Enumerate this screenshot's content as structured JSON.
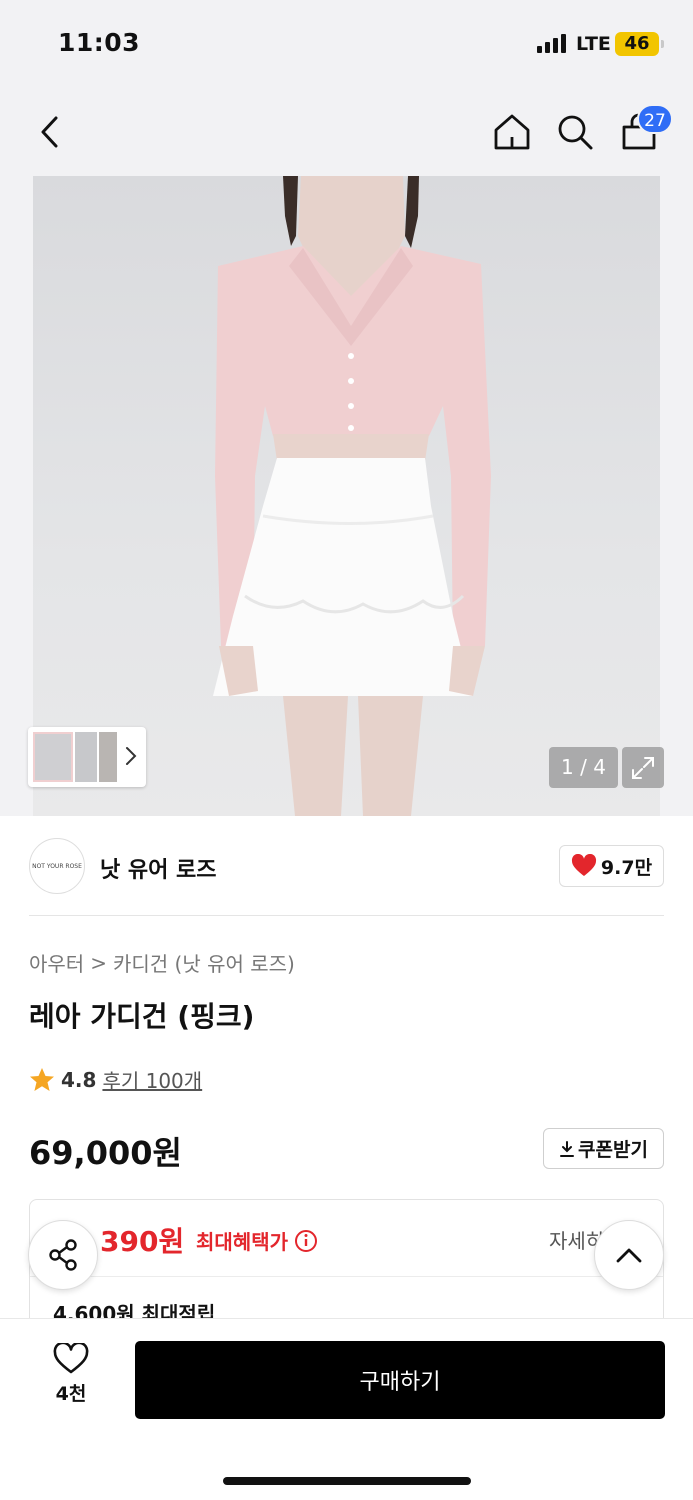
{
  "status_bar": {
    "time": "11:03",
    "network": "LTE",
    "battery": "46"
  },
  "nav": {
    "back_icon": "chevron-left-icon",
    "home_icon": "home-icon",
    "search_icon": "search-icon",
    "cart_icon": "shopping-bag-icon",
    "cart_count": "27"
  },
  "gallery": {
    "page_indicator": "1 / 4",
    "expand_icon": "expand-icon",
    "thumbnails_arrow_icon": "chevron-right-icon"
  },
  "brand": {
    "logo_text": "NOT YOUR ROSE",
    "name": "낫 유어 로즈",
    "likes": "9.7만",
    "heart_color": "#e3262c"
  },
  "breadcrumb": {
    "category": "아우터",
    "separator": ">",
    "subcategory": "카디건 (낫 유어 로즈)"
  },
  "product": {
    "title": "레아 가디건 (핑크)",
    "rating": "4.8",
    "review_link": "후기 100개",
    "price": "69,000원",
    "coupon_label": "쿠폰받기"
  },
  "benefit": {
    "max_benefit_price": "390원",
    "max_benefit_label": "최대혜택가",
    "detail_label": "자세히",
    "points_text": "4,600원 최대적립",
    "accent_color": "#e3262c"
  },
  "bottom": {
    "wish_count": "4천",
    "buy_label": "구매하기"
  }
}
